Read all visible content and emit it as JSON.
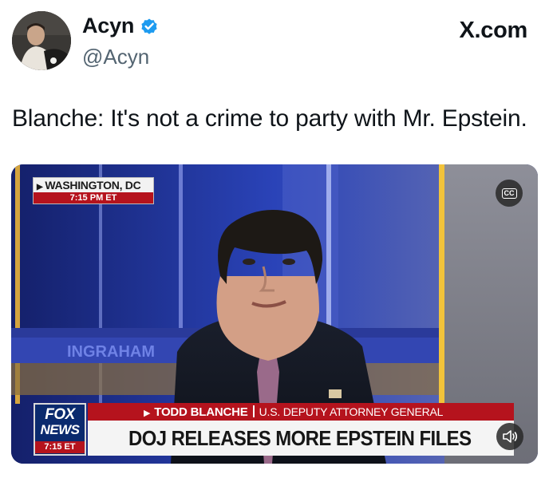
{
  "tweet": {
    "display_name": "Acyn",
    "handle": "@Acyn",
    "verified_icon": "verified-badge-icon",
    "site": "X.com",
    "text": "Blanche: It's not a crime to party with Mr. Epstein."
  },
  "video": {
    "location": "WASHINGTON, DC",
    "location_time": "7:15 PM ET",
    "network_fox": "FOX",
    "network_news": "NEWS",
    "network_time": "7:15 ET",
    "speaker_name": "TODD BLANCHE",
    "speaker_title": "U.S. DEPUTY ATTORNEY GENERAL",
    "headline": "DOJ RELEASES MORE EPSTEIN FILES",
    "captions_icon": "closed-captions-icon",
    "mute_icon": "speaker-volume-icon",
    "background_text": "INGRAHAM"
  },
  "colors": {
    "fox_red": "#b5131d",
    "fox_blue": "#0a2a6e",
    "verified_blue": "#1d9bf0"
  }
}
